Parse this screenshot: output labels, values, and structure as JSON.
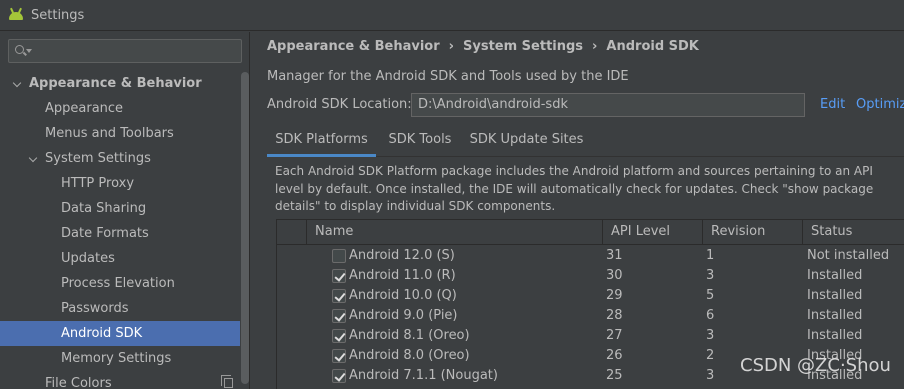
{
  "window": {
    "title": "Settings",
    "app_icon": "android-icon"
  },
  "sidebar": {
    "search": {
      "value": "",
      "placeholder": ""
    },
    "items": [
      {
        "label": "Appearance & Behavior",
        "level": 0,
        "expanded": true,
        "bold": true
      },
      {
        "label": "Appearance",
        "level": 1
      },
      {
        "label": "Menus and Toolbars",
        "level": 1
      },
      {
        "label": "System Settings",
        "level": 1,
        "expanded": true
      },
      {
        "label": "HTTP Proxy",
        "level": 2
      },
      {
        "label": "Data Sharing",
        "level": 2
      },
      {
        "label": "Date Formats",
        "level": 2
      },
      {
        "label": "Updates",
        "level": 2
      },
      {
        "label": "Process Elevation",
        "level": 2
      },
      {
        "label": "Passwords",
        "level": 2
      },
      {
        "label": "Android SDK",
        "level": 2,
        "selected": true
      },
      {
        "label": "Memory Settings",
        "level": 2
      },
      {
        "label": "File Colors",
        "level": 1
      }
    ]
  },
  "breadcrumb": [
    "Appearance & Behavior",
    "System Settings",
    "Android SDK"
  ],
  "breadcrumb_separator": "›",
  "description": "Manager for the Android SDK and Tools used by the IDE",
  "sdk_location": {
    "label": "Android SDK Location:",
    "value": "D:\\Android\\android-sdk",
    "edit_label": "Edit",
    "optimize_label": "Optimize"
  },
  "tabs": [
    {
      "label": "SDK Platforms",
      "active": true
    },
    {
      "label": "SDK Tools",
      "active": false
    },
    {
      "label": "SDK Update Sites",
      "active": false
    }
  ],
  "info_lines": [
    "Each Android SDK Platform package includes the Android platform and sources pertaining to an API",
    "level by default. Once installed, the IDE will automatically check for updates. Check \"show package",
    "details\" to display individual SDK components."
  ],
  "table": {
    "columns": [
      "Name",
      "API Level",
      "Revision",
      "Status"
    ],
    "rows": [
      {
        "checked": false,
        "name": "Android 12.0 (S)",
        "api": "31",
        "revision": "1",
        "status": "Not installed"
      },
      {
        "checked": true,
        "name": "Android 11.0 (R)",
        "api": "30",
        "revision": "3",
        "status": "Installed"
      },
      {
        "checked": true,
        "name": "Android 10.0 (Q)",
        "api": "29",
        "revision": "5",
        "status": "Installed"
      },
      {
        "checked": true,
        "name": "Android 9.0 (Pie)",
        "api": "28",
        "revision": "6",
        "status": "Installed"
      },
      {
        "checked": true,
        "name": "Android 8.1 (Oreo)",
        "api": "27",
        "revision": "3",
        "status": "Installed"
      },
      {
        "checked": true,
        "name": "Android 8.0 (Oreo)",
        "api": "26",
        "revision": "2",
        "status": "Installed"
      },
      {
        "checked": true,
        "name": "Android 7.1.1 (Nougat)",
        "api": "25",
        "revision": "3",
        "status": "Installed"
      }
    ]
  },
  "watermark": "CSDN @ZC·Shou",
  "colors": {
    "background": "#3c3f41",
    "selection": "#4b6eaf",
    "link": "#589df6",
    "tab_underline": "#4a88c7",
    "android_green": "#a4c639"
  }
}
